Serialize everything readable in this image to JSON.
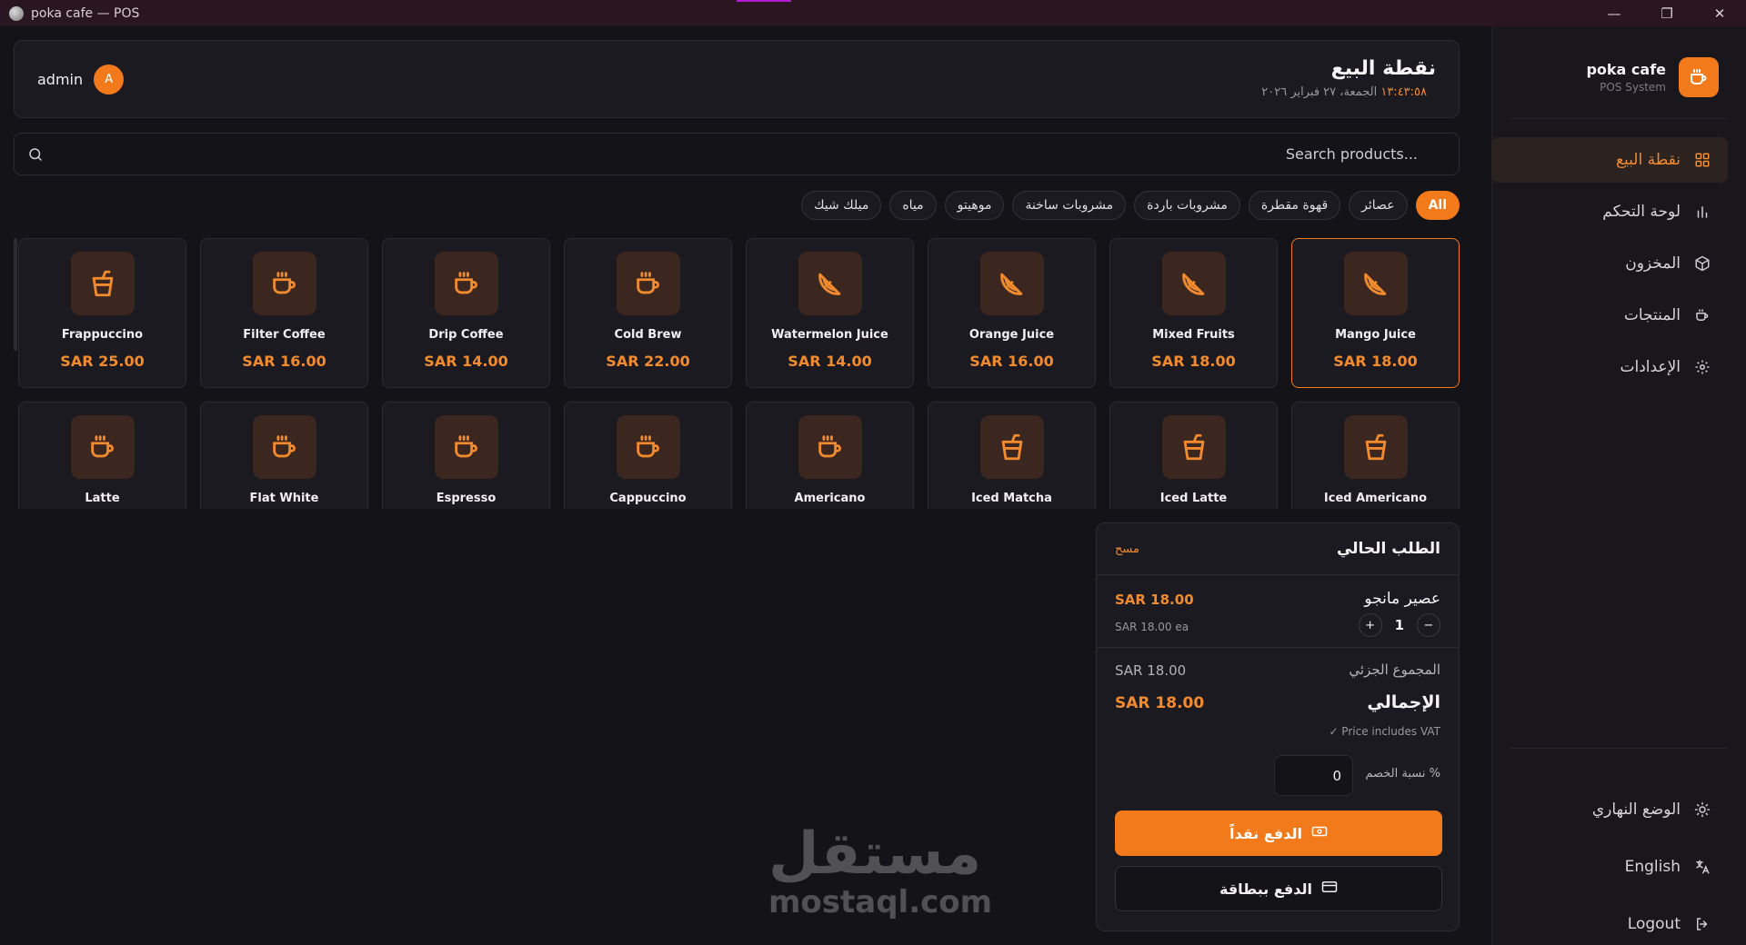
{
  "window": {
    "title": "poka cafe — POS"
  },
  "brand": {
    "name": "poka cafe",
    "subtitle": "POS System"
  },
  "nav": [
    {
      "label": "نقطة البيع",
      "icon": "grid-icon",
      "active": true
    },
    {
      "label": "لوحة التحكم",
      "icon": "chart-icon",
      "active": false
    },
    {
      "label": "المخزون",
      "icon": "box-icon",
      "active": false
    },
    {
      "label": "المنتجات",
      "icon": "cup-icon",
      "active": false
    },
    {
      "label": "الإعدادات",
      "icon": "gear-icon",
      "active": false
    }
  ],
  "bottom_nav": [
    {
      "label": "الوضع النهاري",
      "icon": "sun-icon"
    },
    {
      "label": "English",
      "icon": "translate-icon"
    },
    {
      "label": "Logout",
      "icon": "logout-icon"
    }
  ],
  "header": {
    "title": "نقطة البيع",
    "date": "الجمعة، ٢٧ فبراير ٢٠٢٦",
    "time": "١٣:٤٣:٥٨",
    "user": "admin",
    "avatar_initial": "A"
  },
  "search": {
    "placeholder": "Search products..."
  },
  "categories": [
    "All",
    "عصائر",
    "قهوة مقطرة",
    "مشروبات باردة",
    "مشروبات ساخنة",
    "موهيتو",
    "مياه",
    "ميلك شيك"
  ],
  "products": [
    {
      "name": "Mango Juice",
      "price": "SAR 18.00",
      "icon": "orange-slice-icon",
      "selected": true
    },
    {
      "name": "Mixed Fruits",
      "price": "SAR 18.00",
      "icon": "orange-slice-icon"
    },
    {
      "name": "Orange Juice",
      "price": "SAR 16.00",
      "icon": "orange-slice-icon"
    },
    {
      "name": "Watermelon Juice",
      "price": "SAR 14.00",
      "icon": "orange-slice-icon"
    },
    {
      "name": "Cold Brew",
      "price": "SAR 22.00",
      "icon": "coffee-cup-icon"
    },
    {
      "name": "Drip Coffee",
      "price": "SAR 14.00",
      "icon": "coffee-cup-icon"
    },
    {
      "name": "Filter Coffee",
      "price": "SAR 16.00",
      "icon": "coffee-cup-icon"
    },
    {
      "name": "Frappuccino",
      "price": "SAR 25.00",
      "icon": "iced-cup-icon"
    },
    {
      "name": "Iced Americano",
      "price": "",
      "icon": "iced-cup-icon"
    },
    {
      "name": "Iced Latte",
      "price": "",
      "icon": "iced-cup-icon"
    },
    {
      "name": "Iced Matcha",
      "price": "",
      "icon": "iced-cup-icon"
    },
    {
      "name": "Americano",
      "price": "",
      "icon": "coffee-cup-icon"
    },
    {
      "name": "Cappuccino",
      "price": "",
      "icon": "coffee-cup-icon"
    },
    {
      "name": "Espresso",
      "price": "",
      "icon": "coffee-cup-icon"
    },
    {
      "name": "Flat White",
      "price": "",
      "icon": "coffee-cup-icon"
    },
    {
      "name": "Latte",
      "price": "",
      "icon": "coffee-cup-icon"
    }
  ],
  "order": {
    "title": "الطلب الحالي",
    "clear": "مسح",
    "items": [
      {
        "name": "عصير مانجو",
        "total": "SAR 18.00",
        "each": "SAR 18.00 ea",
        "qty": "1"
      }
    ],
    "subtotal_label": "المجموع الجزئي",
    "subtotal": "SAR 18.00",
    "total_label": "الإجمالي",
    "total": "SAR 18.00",
    "vat_note": "✓ Price includes VAT",
    "discount_label": "نسبة الخصم %",
    "discount_value": "0",
    "pay_cash": "الدفع نقداً",
    "pay_card": "الدفع ببطاقة"
  },
  "watermark": {
    "arabic": "مستقل",
    "latin": "mostaql.com"
  },
  "colors": {
    "accent": "#f27a1a",
    "background": "#141318",
    "panel": "#1b1a20"
  }
}
